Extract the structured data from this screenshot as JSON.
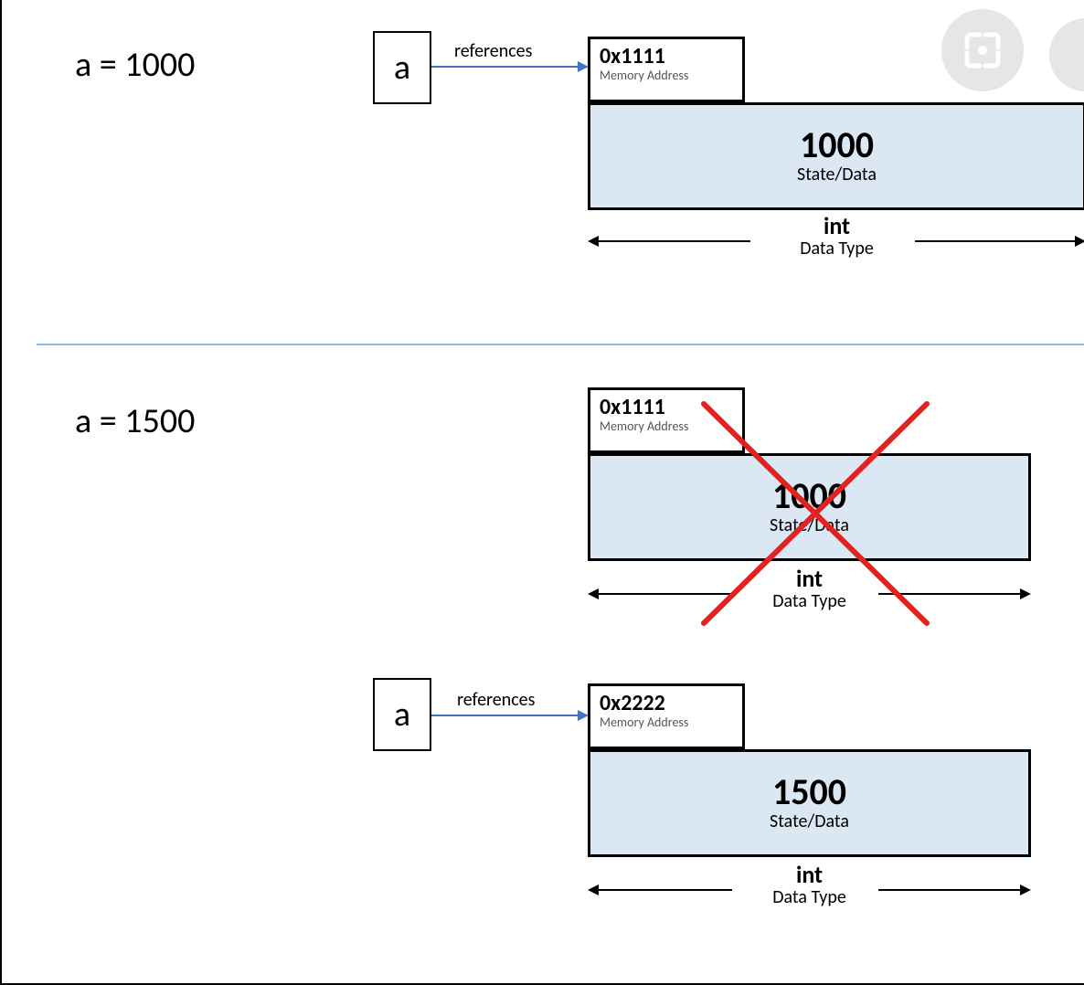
{
  "overlay": {
    "lens_icon": "lens-icon",
    "lens_color": "#ffffff",
    "lens_bg": "#e6e6e6"
  },
  "colors": {
    "state_fill": "#dbe7f3",
    "divider": "#8fbbe8",
    "ref_arrow": "#4472c4",
    "cross": "#e22121"
  },
  "row1": {
    "assignment": "a = 1000",
    "var_name": "a",
    "ref_label": "references",
    "mem": {
      "address": "0x1111",
      "address_sub": "Memory Address",
      "value": "1000",
      "value_sub": "State/Data",
      "dtype": "int",
      "dtype_sub": "Data Type"
    }
  },
  "row2": {
    "assignment": "a = 1500",
    "old_mem": {
      "address": "0x1111",
      "address_sub": "Memory Address",
      "value": "1000",
      "value_sub": "State/Data",
      "dtype": "int",
      "dtype_sub": "Data Type"
    },
    "var_name": "a",
    "ref_label": "references",
    "new_mem": {
      "address": "0x2222",
      "address_sub": "Memory Address",
      "value": "1500",
      "value_sub": "State/Data",
      "dtype": "int",
      "dtype_sub": "Data Type"
    }
  }
}
